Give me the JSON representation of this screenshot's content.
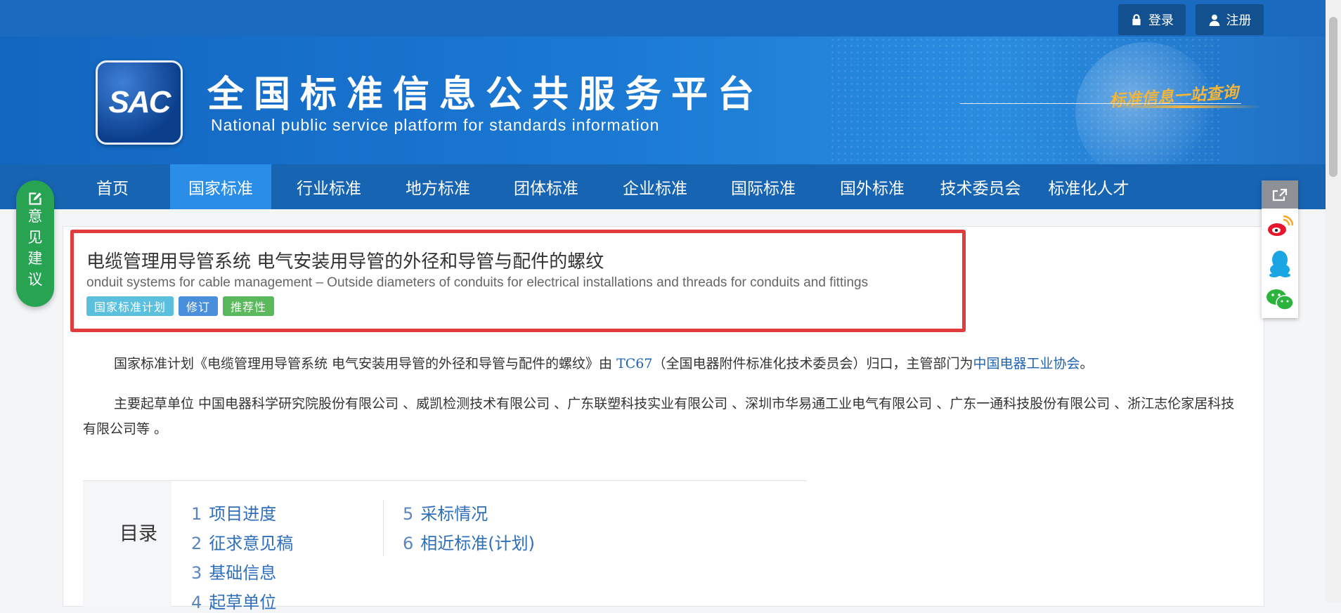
{
  "header": {
    "login_label": "登录",
    "register_label": "注册",
    "logo_text": "SAC",
    "site_title_cn": "全国标准信息公共服务平台",
    "site_title_en": "National public service platform  for standards information",
    "slogan": "标准信息一站查询"
  },
  "nav": {
    "items": [
      "首页",
      "国家标准",
      "行业标准",
      "地方标准",
      "团体标准",
      "企业标准",
      "国际标准",
      "国外标准",
      "技术委员会",
      "标准化人才"
    ],
    "active_index": 1
  },
  "feedback": {
    "label": "意见建议"
  },
  "share": {
    "icons": [
      "share-icon",
      "weibo-icon",
      "qq-icon",
      "wechat-icon"
    ]
  },
  "standard": {
    "title": "电缆管理用导管系统 电气安装用导管的外径和导管与配件的螺纹",
    "en_title": "onduit systems for cable management – Outside diameters of conduits for electrical installations and threads for conduits and fittings",
    "tags": [
      {
        "label": "国家标准计划",
        "color": "#5bc0de"
      },
      {
        "label": "修订",
        "color": "#4a8fdb"
      },
      {
        "label": "推荐性",
        "color": "#5cb85c"
      }
    ]
  },
  "description": {
    "p1_prefix": "国家标准计划《电缆管理用导管系统 电气安装用导管的外径和导管与配件的螺纹》由 ",
    "p1_tc_link": "TC67",
    "p1_middle": "（全国电器附件标准化技术委员会）归口，主管部门为",
    "p1_dept_link": "中国电器工业协会",
    "p1_suffix": "。",
    "p2": "主要起草单位 中国电器科学研究院股份有限公司 、威凯检测技术有限公司 、广东联塑科技实业有限公司 、深圳市华易通工业电气有限公司 、广东一通科技股份有限公司 、浙江志伦家居科技有限公司等 。"
  },
  "toc": {
    "label": "目录",
    "items": [
      {
        "num": "1",
        "label": "项目进度"
      },
      {
        "num": "2",
        "label": "征求意见稿"
      },
      {
        "num": "3",
        "label": "基础信息"
      },
      {
        "num": "4",
        "label": "起草单位"
      },
      {
        "num": "5",
        "label": "采标情况"
      },
      {
        "num": "6",
        "label": "相近标准(计划)"
      }
    ]
  }
}
